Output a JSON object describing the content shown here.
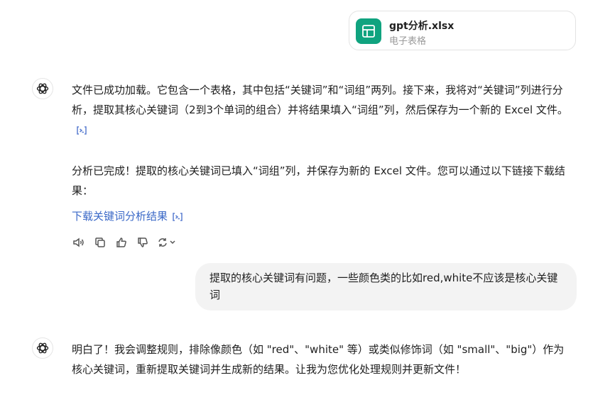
{
  "attachment": {
    "file_name": "gpt分析.xlsx",
    "file_type": "电子表格"
  },
  "assistant_message_1": {
    "paragraph_1": "文件已成功加载。它包含一个表格，其中包括“关键词”和“词组”两列。接下来，我将对“关键词”列进行分析，提取其核心关键词（2到3个单词的组合）并将结果填入“词组”列，然后保存为一个新的 Excel 文件。",
    "paragraph_2": "分析已完成！提取的核心关键词已填入“词组”列，并保存为新的 Excel 文件。您可以通过以下链接下载结果：",
    "download_link": "下载关键词分析结果"
  },
  "action_bar": {
    "icons": [
      "speaker-icon",
      "copy-icon",
      "thumbs-up-icon",
      "thumbs-down-icon",
      "regenerate-icon",
      "chevron-down-icon"
    ]
  },
  "user_message": {
    "text": "提取的核心关键词有问题，一些颜色类的比如red,white不应该是核心关键词"
  },
  "assistant_message_2": {
    "paragraph_1": "明白了！我会调整规则，排除像颜色（如 \"red\"、\"white\" 等）或类似修饰词（如 \"small\"、\"big\"）作为核心关键词，重新提取关键词并生成新的结果。让我为您优化处理规则并更新文件！"
  },
  "colors": {
    "excel_green": "#10a37f",
    "link_blue": "#3a68c7",
    "bubble_gray": "#f3f3f3"
  }
}
